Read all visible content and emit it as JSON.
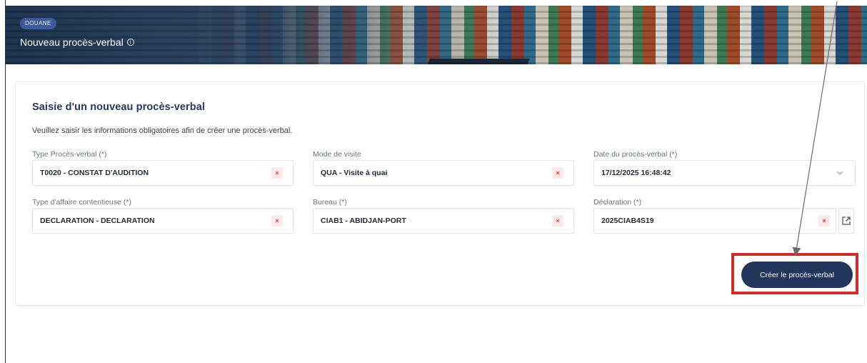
{
  "header": {
    "badge": "DOUANE",
    "title": "Nouveau procès-verbal",
    "info_icon": "info-circle-icon"
  },
  "form": {
    "title": "Saisie d'un nouveau procès-verbal",
    "description": "Veuillez saisir les informations obligatoires afin de créer une procès-verbal.",
    "fields": {
      "type_pv": {
        "label": "Type Procès-verbal (*)",
        "value": "T0020 - CONSTAT D'AUDITION"
      },
      "mode_visite": {
        "label": "Mode de visite",
        "value": "QUA - Visite à quai"
      },
      "date_pv": {
        "label": "Date du procès-verbal (*)",
        "value": "17/12/2025 16:48:42"
      },
      "type_affaire": {
        "label": "Type d'affaire contentieuse (*)",
        "value": "DECLARATION - DECLARATION"
      },
      "bureau": {
        "label": "Bureau (*)",
        "value": "CIAB1 - ABIDJAN-PORT"
      },
      "declaration": {
        "label": "Déclaration (*)",
        "value": "2025CIAB4S19"
      }
    },
    "clear_glyph": "×",
    "create_button": "Créer le procès-verbal"
  },
  "colors": {
    "primary": "#22355a",
    "clear": "#e0383e",
    "highlight": "#c9302c",
    "badge": "#3d5a9e"
  }
}
